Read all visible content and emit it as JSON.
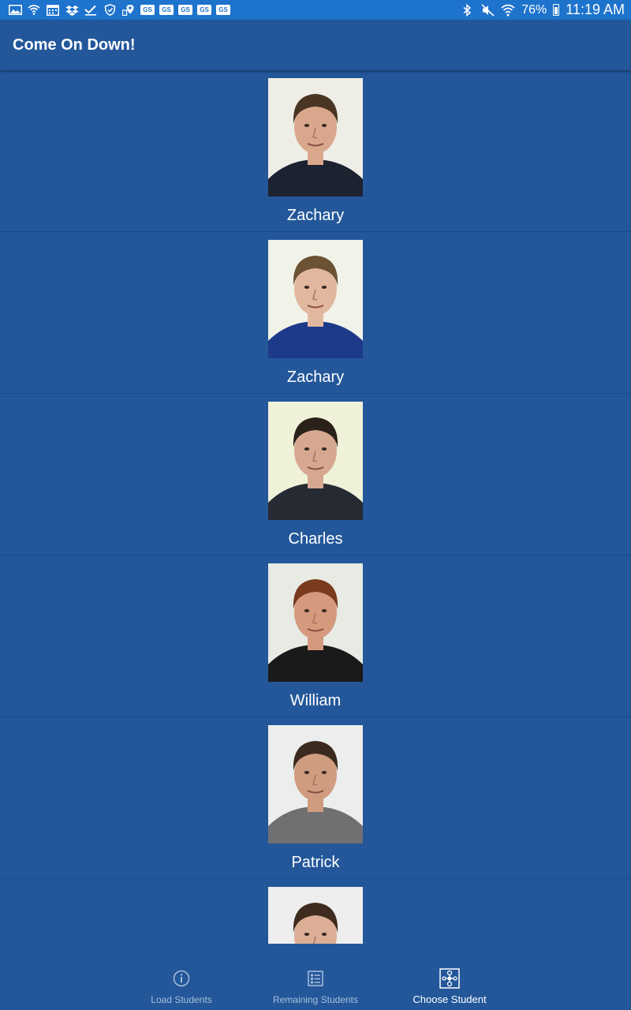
{
  "status_bar": {
    "left_icons": [
      "image-icon",
      "wifi-icon",
      "calendar-icon",
      "dropbox-icon",
      "check-icon",
      "shield-icon",
      "location-icon",
      "gs-badge",
      "gs-badge",
      "gs-badge",
      "gs-badge",
      "gs-badge"
    ],
    "gs_label": "GS",
    "battery": "76%",
    "time": "11:19 AM"
  },
  "app_bar": {
    "title": "Come On Down!"
  },
  "students": [
    {
      "name": "Zachary",
      "photo": {
        "skin": "#d9a88c",
        "hair": "#4a3524",
        "shirt": "#1c2230",
        "bg": "#eeeee6"
      }
    },
    {
      "name": "Zachary",
      "photo": {
        "skin": "#e2b79f",
        "hair": "#6b5233",
        "shirt": "#1d3a8a",
        "bg": "#f1f3e8"
      }
    },
    {
      "name": "Charles",
      "photo": {
        "skin": "#d6a892",
        "hair": "#2a211b",
        "shirt": "#262a33",
        "bg": "#eff2d8"
      }
    },
    {
      "name": "William",
      "photo": {
        "skin": "#d59a7e",
        "hair": "#7a3a1c",
        "shirt": "#1a1a1a",
        "bg": "#e7ebe4"
      }
    },
    {
      "name": "Patrick",
      "photo": {
        "skin": "#cf9c80",
        "hair": "#3b2a1e",
        "shirt": "#707073",
        "bg": "#eceded"
      }
    },
    {
      "name": "",
      "photo": {
        "skin": "#dcae96",
        "hair": "#3f2c1e",
        "shirt": "#2a2a2a",
        "bg": "#eeeeee"
      }
    }
  ],
  "bottom_nav": {
    "load_label": "Load Students",
    "remaining_label": "Remaining Students",
    "choose_label": "Choose Student"
  },
  "colors": {
    "background": "#23579a",
    "status_bar": "#1e73cc",
    "nav_inactive": "#a9bfdc"
  }
}
